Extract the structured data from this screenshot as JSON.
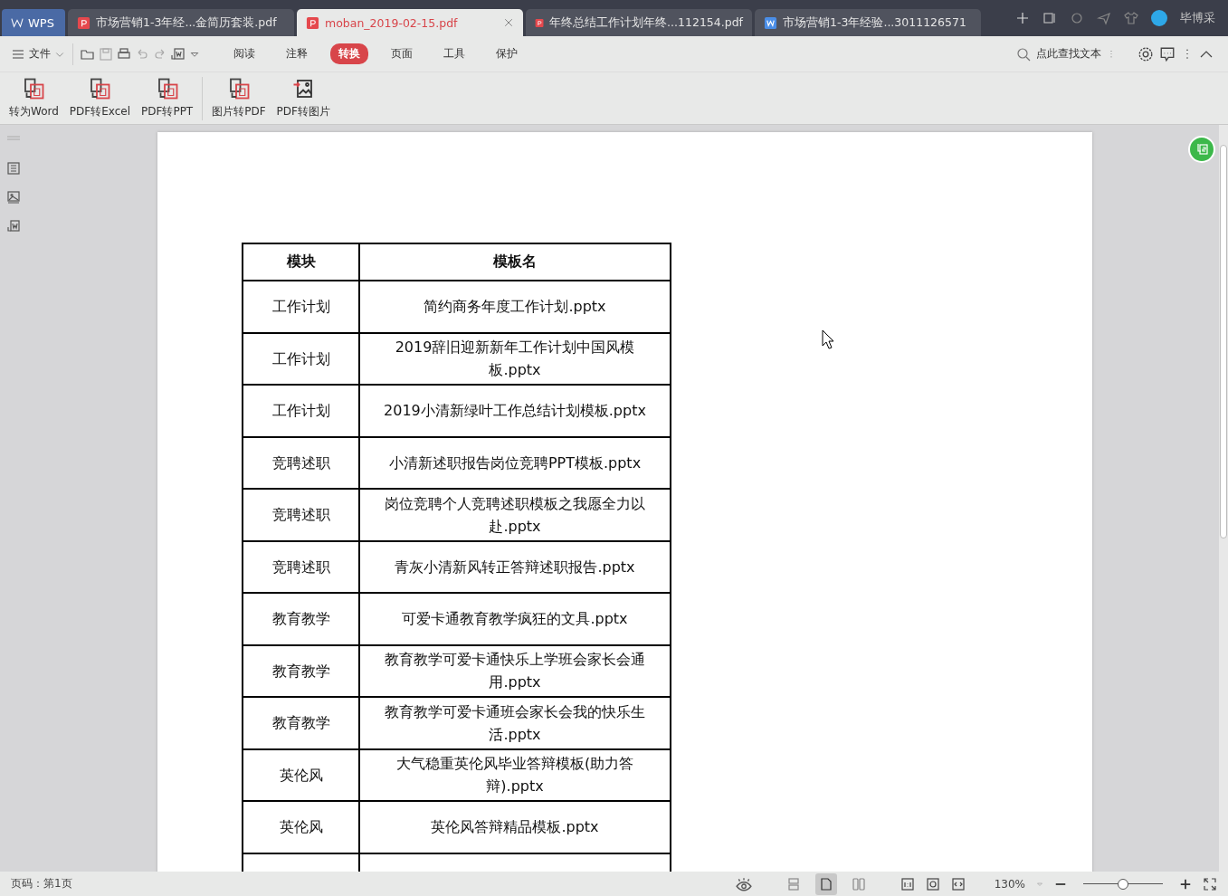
{
  "app_button": {
    "label": "WPS"
  },
  "tabs": [
    {
      "label": "市场营销1-3年经...金简历套装.pdf",
      "kind": "pdf",
      "selected": false
    },
    {
      "label": "moban_2019-02-15.pdf",
      "kind": "pdf",
      "selected": true
    },
    {
      "label": "年终总结工作计划年终...112154.pdf",
      "kind": "pdf",
      "selected": false
    },
    {
      "label": "市场营销1-3年经验...3011126571",
      "kind": "word",
      "selected": false
    }
  ],
  "user": {
    "name": "毕博采"
  },
  "menu": {
    "file": "文件",
    "tabs": [
      {
        "label": "阅读",
        "selected": false
      },
      {
        "label": "注释",
        "selected": false
      },
      {
        "label": "转换",
        "selected": true
      },
      {
        "label": "页面",
        "selected": false
      },
      {
        "label": "工具",
        "selected": false
      },
      {
        "label": "保护",
        "selected": false
      }
    ],
    "search_placeholder": "点此查找文本"
  },
  "ribbon": [
    {
      "label": "转为Word",
      "kind": "word"
    },
    {
      "label": "PDF转Excel",
      "kind": "excel"
    },
    {
      "label": "PDF转PPT",
      "kind": "ppt"
    },
    {
      "label": "图片转PDF",
      "kind": "pdf"
    },
    {
      "label": "PDF转图片",
      "kind": "image"
    }
  ],
  "table": {
    "columns": [
      "模块",
      "模板名"
    ],
    "rows": [
      [
        "工作计划",
        "简约商务年度工作计划.pptx"
      ],
      [
        "工作计划",
        "2019辞旧迎新新年工作计划中国风模板.pptx"
      ],
      [
        "工作计划",
        "2019小清新绿叶工作总结计划模板.pptx"
      ],
      [
        "竞聘述职",
        "小清新述职报告岗位竞聘PPT模板.pptx"
      ],
      [
        "竞聘述职",
        "岗位竞聘个人竞聘述职模板之我愿全力以赴.pptx"
      ],
      [
        "竞聘述职",
        "青灰小清新风转正答辩述职报告.pptx"
      ],
      [
        "教育教学",
        "可爱卡通教育教学疯狂的文具.pptx"
      ],
      [
        "教育教学",
        "教育教学可爱卡通快乐上学班会家长会通用.pptx"
      ],
      [
        "教育教学",
        "教育教学可爱卡通班会家长会我的快乐生活.pptx"
      ],
      [
        "英伦风",
        "大气稳重英伦风毕业答辩模板(助力答辩).pptx"
      ],
      [
        "英伦风",
        "英伦风答辩精品模板.pptx"
      ]
    ]
  },
  "status_bar": {
    "page": "页码：第1页",
    "views": [
      {
        "kind": "continuous",
        "selected": false
      },
      {
        "kind": "single",
        "selected": true
      },
      {
        "kind": "double",
        "selected": false
      }
    ],
    "zoom": "130%",
    "zoom_slider": {
      "level": 0.5
    }
  }
}
